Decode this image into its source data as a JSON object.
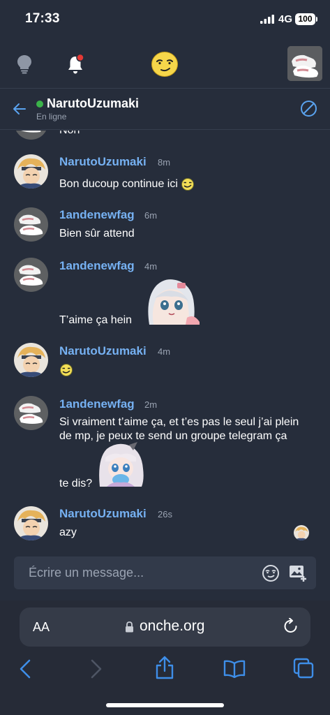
{
  "status_bar": {
    "time": "17:33",
    "network": "4G",
    "battery": "100"
  },
  "top_nav": {
    "icons": [
      "lightbulb-icon",
      "bell-icon",
      "smiley-icon",
      "avatar"
    ]
  },
  "chat": {
    "contact_name": "NarutoUzumaki",
    "contact_status": "En ligne",
    "cut_off_text": "Non"
  },
  "messages": [
    {
      "author": "NarutoUzumaki",
      "time": "8m",
      "text": "Bon ducoup continue ici"
    },
    {
      "author": "1andenewfag",
      "time": "6m",
      "text": "Bien sûr attend"
    },
    {
      "author": "1andenewfag",
      "time": "4m",
      "text": "T’aime ça hein"
    },
    {
      "author": "NarutoUzumaki",
      "time": "4m",
      "text": ""
    },
    {
      "author": "1andenewfag",
      "time": "2m",
      "text_line1": "Si vraiment t’aime ça, et t’es pas le seul j’ai plein",
      "text_line2": "de mp, je peux te send un groupe telegram ça",
      "text_line3": "te dis?"
    },
    {
      "author": "NarutoUzumaki",
      "time": "26s",
      "text": "azy"
    }
  ],
  "composer": {
    "placeholder": "Écrire un message..."
  },
  "browser": {
    "aa": "AA",
    "url": "onche.org"
  },
  "colors": {
    "background": "#262d3b",
    "author": "#76b1f2",
    "online": "#3bb34a",
    "accent": "#3e8ee8"
  }
}
